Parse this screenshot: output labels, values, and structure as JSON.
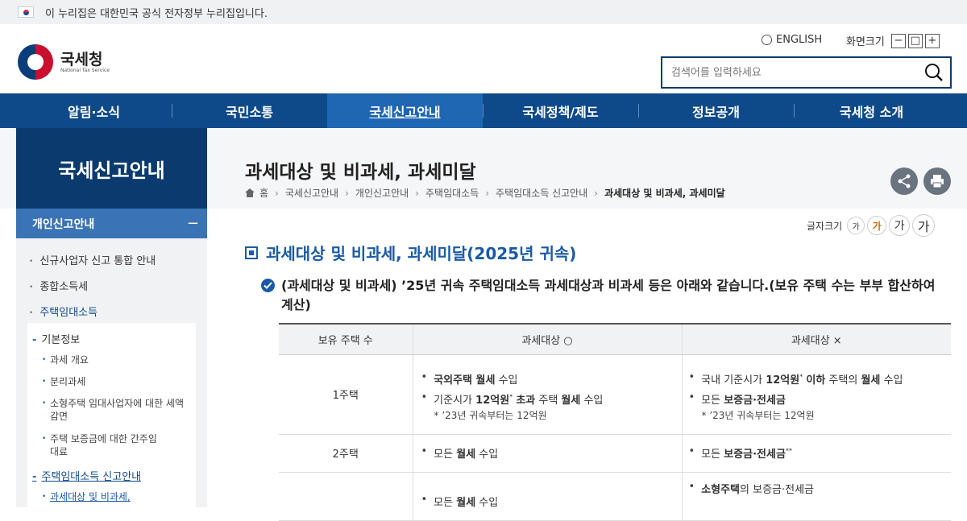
{
  "topbar": {
    "notice": "이 누리집은 대한민국 공식 전자정부 누리집입니다."
  },
  "logo": {
    "name": "국세청",
    "sub": "National Tax Service"
  },
  "utility": {
    "english": "ENGLISH",
    "zoom_label": "화면크기",
    "zoom_out": "−",
    "zoom_reset": "□",
    "zoom_in": "+"
  },
  "search": {
    "placeholder": "검색어를 입력하세요"
  },
  "nav": {
    "items": [
      "알림·소식",
      "국민소통",
      "국세신고안내",
      "국세정책/제도",
      "정보공개",
      "국세청 소개"
    ]
  },
  "sidebar": {
    "title": "국세신고안내",
    "head": "개인신고안내",
    "head_toggle": "−",
    "level1": [
      "신규사업자 신고 통합 안내",
      "종합소득세",
      "주택임대소득"
    ],
    "level2": [
      "기본정보",
      "주택임대소득 신고안내"
    ],
    "level3": [
      "과세 개요",
      "분리과세",
      "소형주택 임대사업자에 대한 세액 감면",
      "주택 보증금에 대한 간주임대료",
      "과세대상 및 비과세,"
    ]
  },
  "page": {
    "title": "과세대상 및 비과세, 과세미달"
  },
  "breadcrumb": [
    "홈",
    "국세신고안내",
    "개인신고안내",
    "주택임대소득",
    "주택임대소득 신고안내",
    "과세대상 및 비과세, 과세미달"
  ],
  "font_size": {
    "label": "글자크기",
    "options": [
      "가",
      "가",
      "가",
      "가"
    ]
  },
  "section": {
    "title": "과세대상 및 비과세, 과세미달(2025년 귀속)",
    "lead": "(과세대상 및 비과세) ’25년 귀속 주택임대소득 과세대상과 비과세 등은 아래와 같습니다.(보유 주택 수는 부부 합산하여 계산)"
  },
  "table": {
    "headers": [
      "보유 주택 수",
      "과세대상 ○",
      "과세대상 ×"
    ],
    "rows": [
      {
        "count": "1주택",
        "taxable": [
          "국외주택 월세 수입",
          "기준시가 12억원* 초과 주택 월세 수입"
        ],
        "taxable_note": "* ’23년 귀속부터는 12억원",
        "nontaxable": [
          "국내 기준시가 12억원* 이하 주택의 월세 수입",
          "모든 보증금·전세금"
        ],
        "nontaxable_note": "* ’23년 귀속부터는 12억원"
      },
      {
        "count": "2주택",
        "taxable": [
          "모든 월세 수입"
        ],
        "nontaxable": [
          "모든 보증금·전세금**"
        ]
      },
      {
        "count": "",
        "taxable": [
          "모든 월세 수입"
        ],
        "nontaxable": [
          "소형주택의 보증금·전세금"
        ]
      }
    ]
  }
}
